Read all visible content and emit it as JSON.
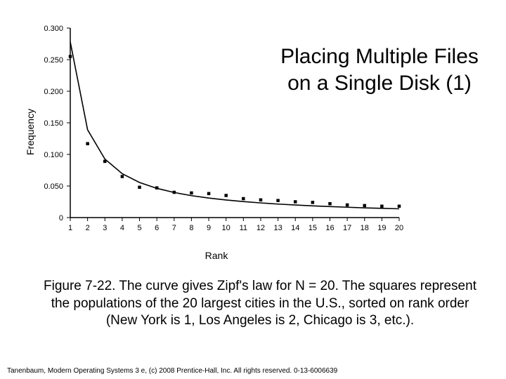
{
  "title": "Placing Multiple Files on a Single Disk (1)",
  "caption": "Figure 7-22. The curve gives Zipf's law for N = 20. The squares represent the populations of the 20 largest cities in the U.S., sorted on rank order (New York is 1, Los Angeles is 2, Chicago is 3, etc.).",
  "footer": "Tanenbaum, Modern Operating Systems 3 e, (c) 2008 Prentice-Hall, Inc. All rights reserved. 0-13-6006639",
  "chart_data": {
    "type": "scatter+line",
    "title": "",
    "xlabel": "Rank",
    "ylabel": "Frequency",
    "xlim": [
      1,
      20
    ],
    "ylim": [
      0,
      0.3
    ],
    "xticks": [
      1,
      2,
      3,
      4,
      5,
      6,
      7,
      8,
      9,
      10,
      11,
      12,
      13,
      14,
      15,
      16,
      17,
      18,
      19,
      20
    ],
    "yticks": [
      0,
      0.05,
      0.1,
      0.15,
      0.2,
      0.25,
      0.3
    ],
    "ytick_labels": [
      "0",
      "0.050",
      "0.100",
      "0.150",
      "0.200",
      "0.250",
      "0.300"
    ],
    "series": [
      {
        "name": "Zipf's law (N=20)",
        "kind": "line",
        "x": [
          1,
          2,
          3,
          4,
          5,
          6,
          7,
          8,
          9,
          10,
          11,
          12,
          13,
          14,
          15,
          16,
          17,
          18,
          19,
          20
        ],
        "y": [
          0.278,
          0.139,
          0.0926,
          0.0695,
          0.0556,
          0.0463,
          0.0397,
          0.0347,
          0.0309,
          0.0278,
          0.0253,
          0.0232,
          0.0214,
          0.0199,
          0.0185,
          0.0174,
          0.0164,
          0.0154,
          0.0146,
          0.0139
        ]
      },
      {
        "name": "City populations (top 20 US cities)",
        "kind": "scatter",
        "marker": "square",
        "x": [
          1,
          2,
          3,
          4,
          5,
          6,
          7,
          8,
          9,
          10,
          11,
          12,
          13,
          14,
          15,
          16,
          17,
          18,
          19,
          20
        ],
        "y": [
          0.255,
          0.117,
          0.089,
          0.065,
          0.048,
          0.047,
          0.04,
          0.039,
          0.038,
          0.035,
          0.03,
          0.028,
          0.027,
          0.025,
          0.024,
          0.022,
          0.02,
          0.019,
          0.018,
          0.018
        ]
      }
    ]
  }
}
